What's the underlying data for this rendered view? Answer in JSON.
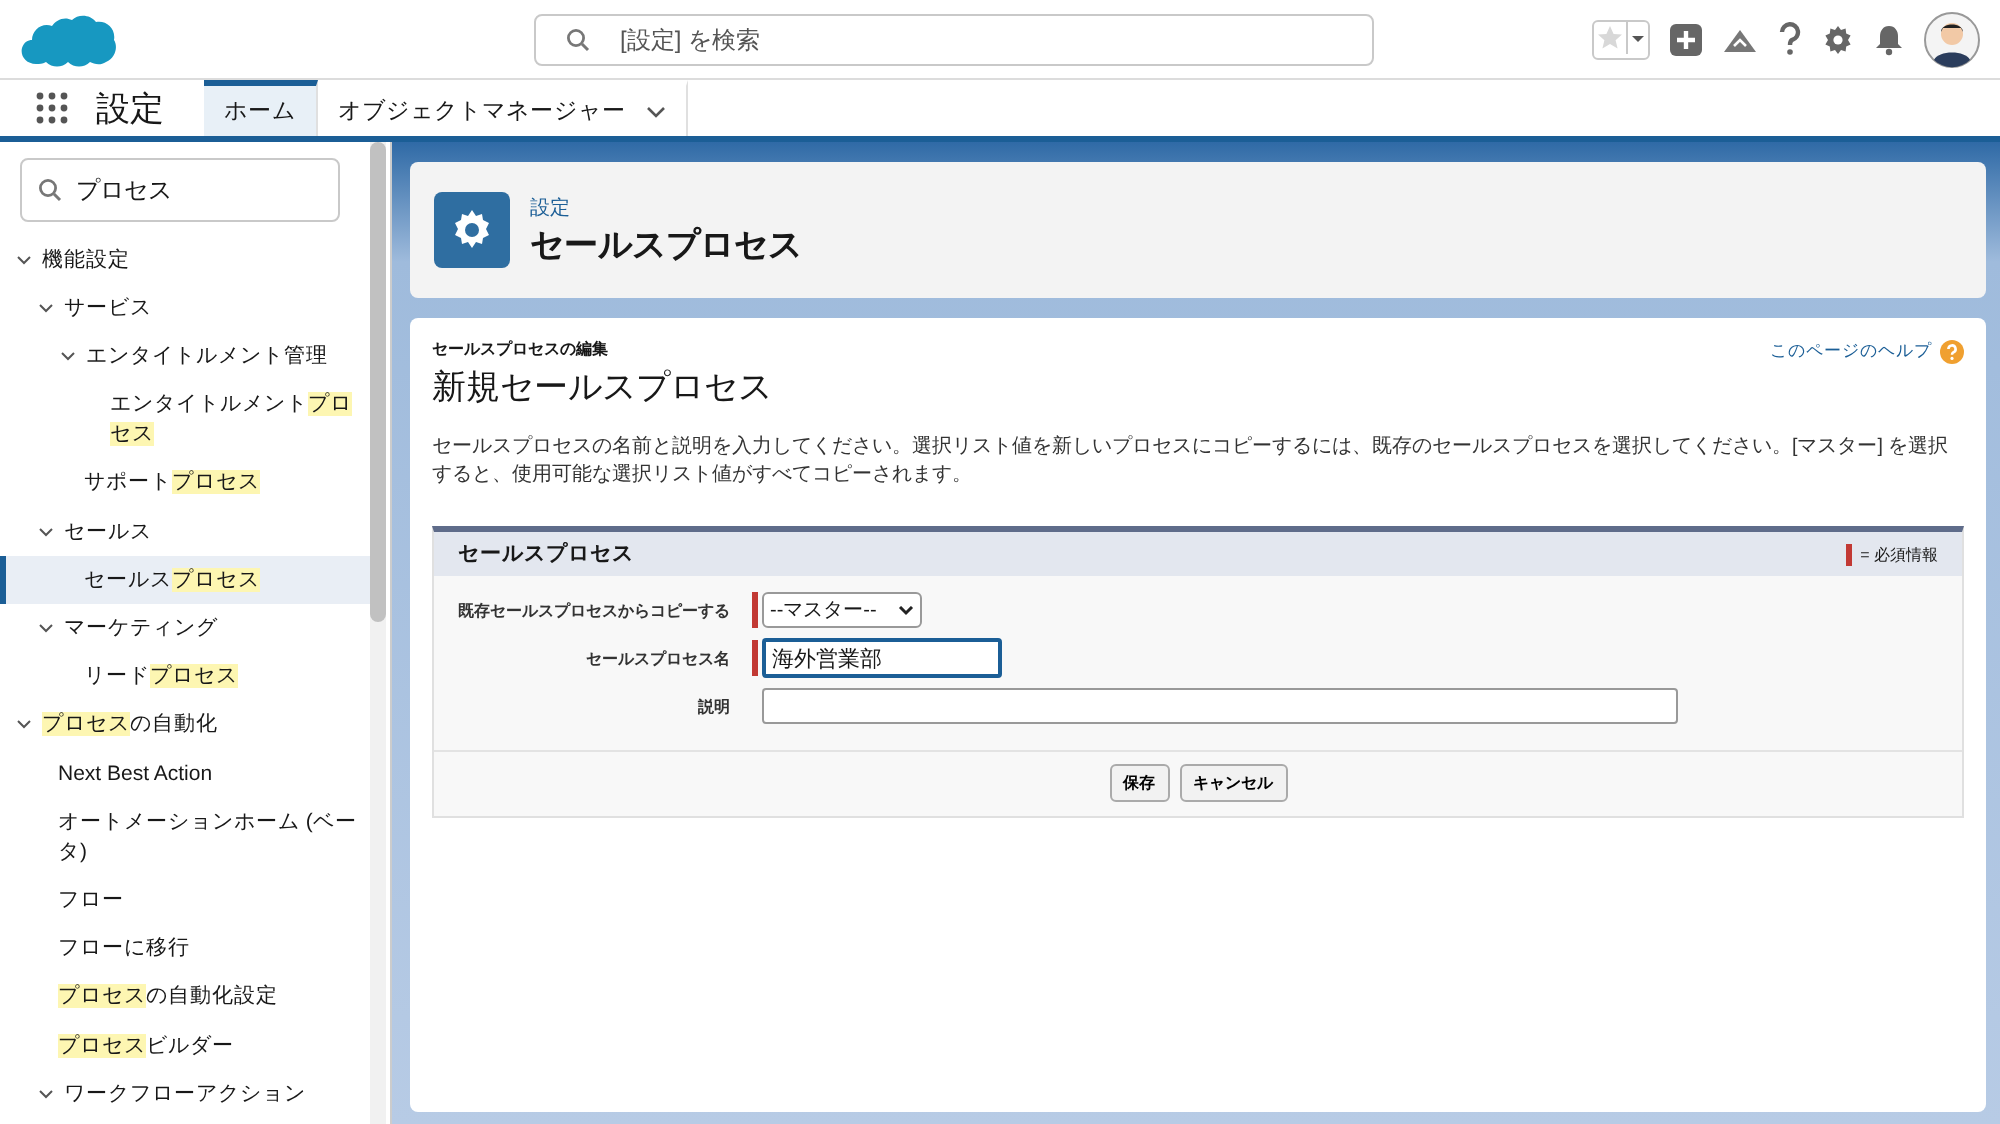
{
  "header": {
    "search_placeholder": "[設定] を検索"
  },
  "nav": {
    "app_title": "設定",
    "tabs": [
      {
        "label": "ホーム",
        "selected": true,
        "kind": "tab"
      },
      {
        "label": "オブジェクトマネージャー",
        "selected": false,
        "kind": "menu"
      }
    ]
  },
  "sidebar": {
    "search_value": "プロセス",
    "tree": [
      {
        "parts": [
          {
            "text": "機能設定",
            "highlight": false
          }
        ],
        "expanded": true,
        "selected": false,
        "children": [
          {
            "parts": [
              {
                "text": "サービス",
                "highlight": false
              }
            ],
            "expanded": true,
            "selected": false,
            "children": [
              {
                "parts": [
                  {
                    "text": "エンタイトルメント管理",
                    "highlight": false
                  }
                ],
                "expanded": true,
                "selected": false,
                "children": [
                  {
                    "parts": [
                      {
                        "text": "エンタイトルメント",
                        "highlight": false
                      },
                      {
                        "text": "プロセス",
                        "highlight": true
                      }
                    ],
                    "selected": false
                  }
                ]
              },
              {
                "parts": [
                  {
                    "text": "サポート",
                    "highlight": false
                  },
                  {
                    "text": "プロセス",
                    "highlight": true
                  }
                ],
                "selected": false
              }
            ]
          },
          {
            "parts": [
              {
                "text": "セールス",
                "highlight": false
              }
            ],
            "expanded": true,
            "selected": false,
            "children": [
              {
                "parts": [
                  {
                    "text": "セールス",
                    "highlight": false
                  },
                  {
                    "text": "プロセス",
                    "highlight": true
                  }
                ],
                "selected": true
              }
            ]
          },
          {
            "parts": [
              {
                "text": "マーケティング",
                "highlight": false
              }
            ],
            "expanded": true,
            "selected": false,
            "children": [
              {
                "parts": [
                  {
                    "text": "リード",
                    "highlight": false
                  },
                  {
                    "text": "プロセス",
                    "highlight": true
                  }
                ],
                "selected": false
              }
            ]
          }
        ]
      },
      {
        "parts": [
          {
            "text": "プロセス",
            "highlight": true
          },
          {
            "text": "の自動化",
            "highlight": false
          }
        ],
        "expanded": true,
        "selected": false,
        "children": [
          {
            "parts": [
              {
                "text": "Next Best Action",
                "highlight": false
              }
            ],
            "selected": false
          },
          {
            "parts": [
              {
                "text": "オートメーションホーム (ベータ)",
                "highlight": false
              }
            ],
            "selected": false
          },
          {
            "parts": [
              {
                "text": "フロー",
                "highlight": false
              }
            ],
            "selected": false
          },
          {
            "parts": [
              {
                "text": "フローに移行",
                "highlight": false
              }
            ],
            "selected": false
          },
          {
            "parts": [
              {
                "text": "プロセス",
                "highlight": true
              },
              {
                "text": "の自動化設定",
                "highlight": false
              }
            ],
            "selected": false
          },
          {
            "parts": [
              {
                "text": "プロセス",
                "highlight": true
              },
              {
                "text": "ビルダー",
                "highlight": false
              }
            ],
            "selected": false
          },
          {
            "parts": [
              {
                "text": "ワークフローアクション",
                "highlight": false
              }
            ],
            "expanded": true,
            "selected": false
          }
        ]
      }
    ]
  },
  "page_header": {
    "breadcrumb": "設定",
    "title": "セールスプロセス"
  },
  "form": {
    "subtitle": "セールスプロセスの編集",
    "title": "新規セールスプロセス",
    "help_link": "このページのヘルプ",
    "description": "セールスプロセスの名前と説明を入力してください。選択リスト値を新しいプロセスにコピーするには、既存のセールスプロセスを選択してください。[マスター] を選択すると、使用可能な選択リスト値がすべてコピーされます。",
    "section_title": "セールスプロセス",
    "required_legend": "= 必須情報",
    "fields": [
      {
        "label": "既存セールスプロセスからコピーする",
        "kind": "select",
        "value": "--マスター--",
        "required": true,
        "focused": false
      },
      {
        "label": "セールスプロセス名",
        "kind": "text",
        "value": "海外営業部",
        "required": true,
        "focused": true
      },
      {
        "label": "説明",
        "kind": "text",
        "required": false,
        "focused": false
      }
    ],
    "buttons": [
      "保存",
      "キャンセル"
    ]
  }
}
